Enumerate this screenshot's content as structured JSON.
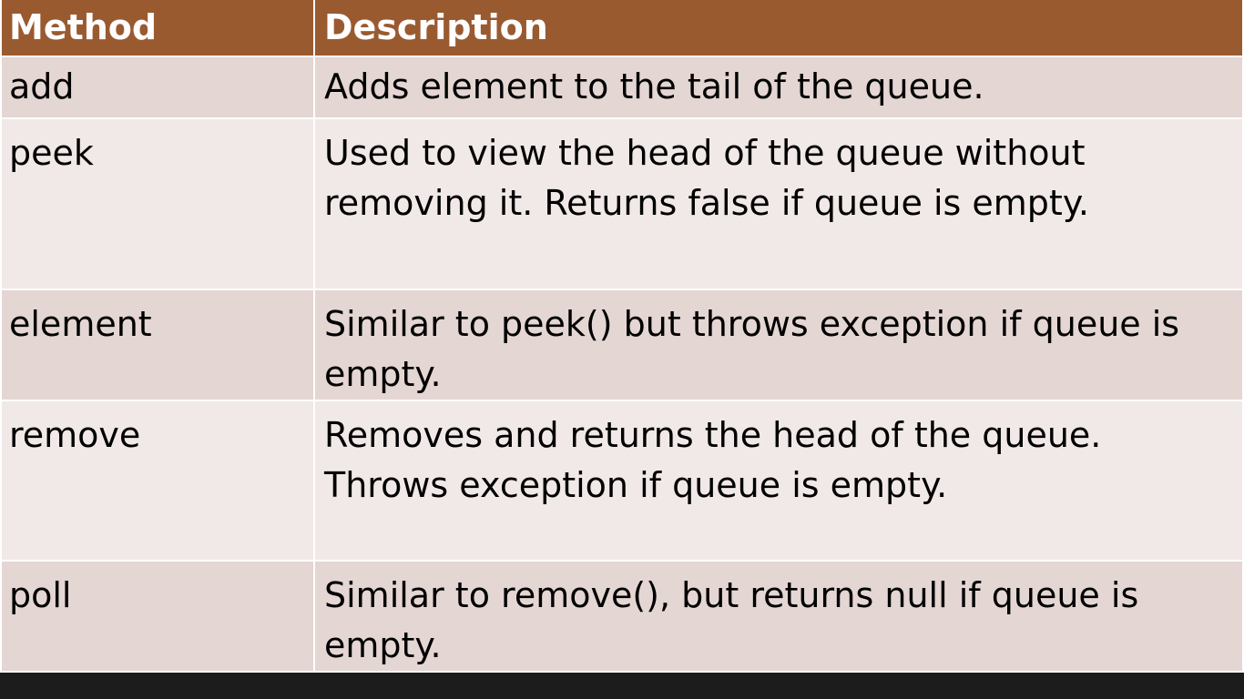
{
  "table": {
    "header": {
      "method": "Method",
      "description": "Description"
    },
    "rows": [
      {
        "method": "add",
        "description": "Adds element to the tail of the queue."
      },
      {
        "method": "peek",
        "description": "Used to view the head of the queue without removing it. Returns false if queue is empty."
      },
      {
        "method": "element",
        "description": "Similar to peek() but throws exception if queue is empty."
      },
      {
        "method": "remove",
        "description": "Removes and returns the head of the queue. Throws exception if queue is empty."
      },
      {
        "method": "poll",
        "description": "Similar to remove(), but returns null if queue is empty."
      }
    ]
  },
  "colors": {
    "header_background": "#9a5a30",
    "row_shade_a": "#e4d6d3",
    "row_shade_b": "#f1e9e7"
  }
}
